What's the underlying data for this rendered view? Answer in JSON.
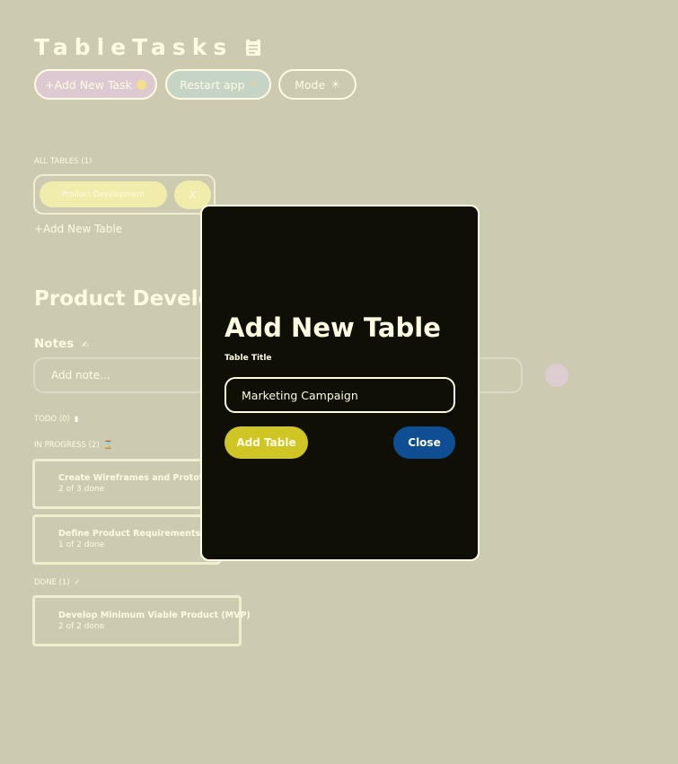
{
  "app": {
    "title": "TableTasks",
    "title_icon": "clipboard-icon"
  },
  "toolbar": {
    "add_task_label": "+Add New Task",
    "add_task_icon": "smile-face-icon",
    "restart_label": "Restart app",
    "restart_icon": "broom-icon",
    "mode_label": "Mode",
    "mode_icon": "sun-icon"
  },
  "tables": {
    "header": "ALL TABLES (1)",
    "items": [
      {
        "label": "Product Development",
        "delete_label": "X"
      }
    ],
    "add_table_label": "+Add New Table"
  },
  "board": {
    "title": "Product Development",
    "notes_label": "Notes",
    "notes_icon": "writing-hand-icon",
    "note_placeholder": "Add note...",
    "sections": {
      "todo": {
        "label": "TODO (0)",
        "icon": "trash-icon"
      },
      "in_progress": {
        "label": "IN PROGRESS (2)",
        "icon": "hourglass-icon",
        "tasks": [
          {
            "title": "Create Wireframes and Prototypes",
            "progress": "2 of 3 done"
          },
          {
            "title": "Define Product Requirements",
            "progress": "1 of 2 done"
          }
        ]
      },
      "done": {
        "label": "DONE (1)",
        "icon": "check-icon",
        "tasks": [
          {
            "title": "Develop Minimum Viable Product (MVP)",
            "progress": "2 of 2 done"
          }
        ]
      }
    }
  },
  "modal": {
    "title": "Add New Table",
    "field_label": "Table Title",
    "field_value": "Marketing Campaign",
    "submit_label": "Add Table",
    "close_label": "Close"
  },
  "colors": {
    "background": "#cccbb1",
    "text_light": "#fffbe3",
    "add_task_button": "#dcc9d1",
    "restart_button": "#c6d4c6",
    "table_pill": "#f0ecab",
    "modal_background": "#0f0f06",
    "add_table_button": "#cfc626",
    "close_button": "#0f4e93",
    "note_add_button": "#ddcdd0"
  }
}
